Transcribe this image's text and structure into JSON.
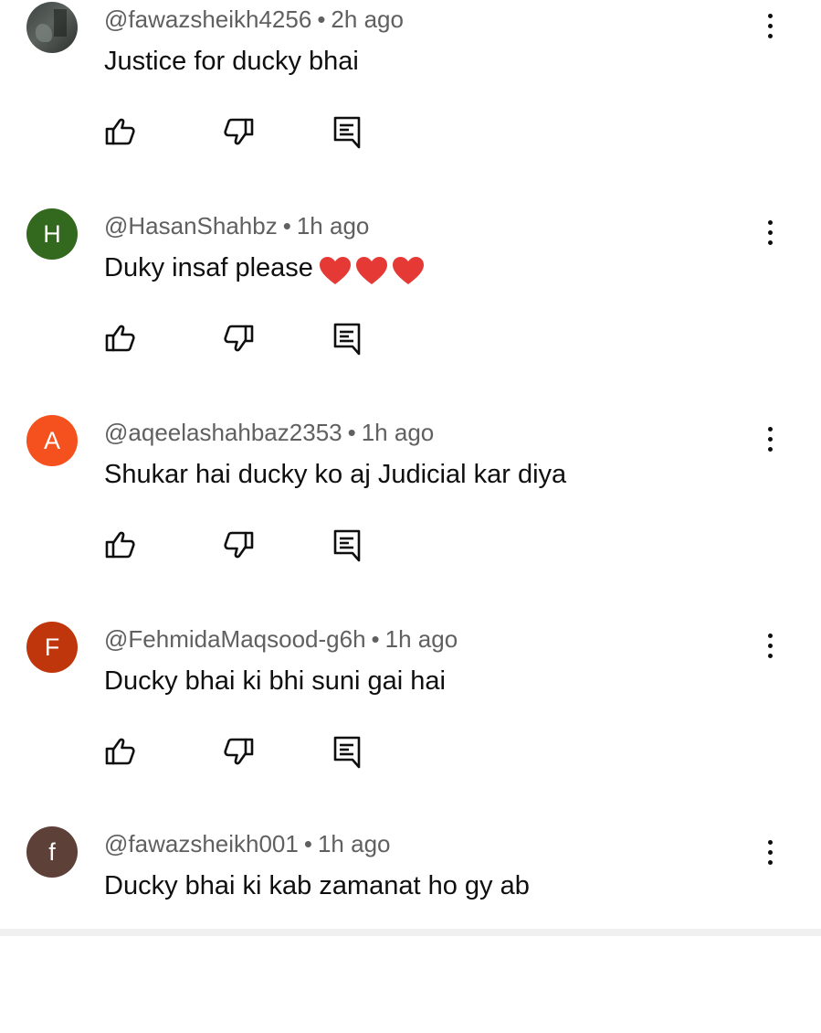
{
  "comments": [
    {
      "handle": "@fawazsheikh4256",
      "time": "2h ago",
      "text": "Justice for ducky bhai",
      "avatar_letter": "",
      "avatar_color": "#4a504c",
      "avatar_type": "photo"
    },
    {
      "handle": "@HasanShahbz",
      "time": "1h ago",
      "text": "Duky insaf please",
      "emoji": "❤️❤️❤️",
      "avatar_letter": "H",
      "avatar_color": "#33691e"
    },
    {
      "handle": "@aqeelashahbaz2353",
      "time": "1h ago",
      "text": "Shukar hai ducky ko aj Judicial kar diya",
      "avatar_letter": "A",
      "avatar_color": "#f4511e"
    },
    {
      "handle": "@FehmidaMaqsood-g6h",
      "time": "1h ago",
      "text": "Ducky bhai ki bhi suni gai hai",
      "avatar_letter": "F",
      "avatar_color": "#bf360c"
    },
    {
      "handle": "@fawazsheikh001",
      "time": "1h ago",
      "text": "Ducky bhai ki kab zamanat ho gy ab",
      "avatar_letter": "f",
      "avatar_color": "#5d4037"
    }
  ],
  "separator": "•",
  "icons": {
    "like": "thumbs-up-icon",
    "dislike": "thumbs-down-icon",
    "reply": "reply-comment-icon",
    "menu": "more-vertical-icon"
  },
  "colors": {
    "meta_text": "#606060",
    "body_text": "#0f0f0f",
    "heart": "#e53935"
  }
}
